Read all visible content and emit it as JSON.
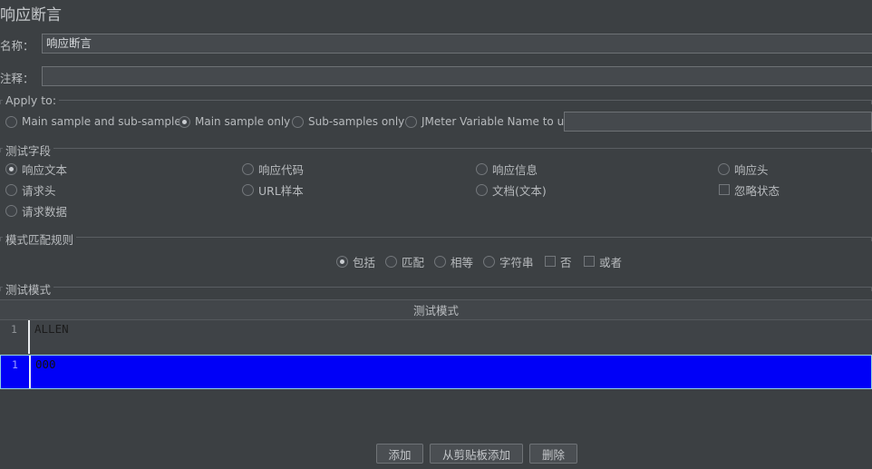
{
  "window": {
    "title": "响应断言"
  },
  "fields": {
    "name_label": "名称：",
    "name_value": "响应断言",
    "comment_label": "注释：",
    "comment_value": ""
  },
  "apply_to": {
    "group_title": "Apply to:",
    "options": [
      {
        "label": "Main sample and sub-samples",
        "checked": false
      },
      {
        "label": "Main sample only",
        "checked": true
      },
      {
        "label": "Sub-samples only",
        "checked": false
      },
      {
        "label": "JMeter Variable Name to use",
        "checked": false
      }
    ],
    "variable_value": ""
  },
  "test_field": {
    "group_title": "测试字段",
    "column1": [
      {
        "label": "响应文本",
        "checked": true,
        "type": "radio"
      },
      {
        "label": "请求头",
        "checked": false,
        "type": "radio"
      },
      {
        "label": "请求数据",
        "checked": false,
        "type": "radio"
      }
    ],
    "column2": [
      {
        "label": "响应代码",
        "checked": false,
        "type": "radio"
      },
      {
        "label": "URL样本",
        "checked": false,
        "type": "radio"
      }
    ],
    "column3": [
      {
        "label": "响应信息",
        "checked": false,
        "type": "radio"
      },
      {
        "label": "文档(文本)",
        "checked": false,
        "type": "radio"
      }
    ],
    "column4": [
      {
        "label": "响应头",
        "checked": false,
        "type": "radio"
      },
      {
        "label": "忽略状态",
        "checked": false,
        "type": "checkbox"
      }
    ]
  },
  "pattern_rules": {
    "group_title": "模式匹配规则",
    "options": [
      {
        "label": "包括",
        "checked": true,
        "type": "radio"
      },
      {
        "label": "匹配",
        "checked": false,
        "type": "radio"
      },
      {
        "label": "相等",
        "checked": false,
        "type": "radio"
      },
      {
        "label": "字符串",
        "checked": false,
        "type": "radio"
      },
      {
        "label": "否",
        "checked": false,
        "type": "checkbox"
      },
      {
        "label": "或者",
        "checked": false,
        "type": "checkbox"
      }
    ]
  },
  "test_patterns": {
    "group_title": "测试模式",
    "column_header": "测试模式",
    "rows": [
      {
        "num": "1",
        "value": "ALLEN",
        "selected": false
      },
      {
        "num": "1",
        "value": "000",
        "selected": true
      }
    ]
  },
  "buttons": {
    "add": "添加",
    "add_from_clipboard": "从剪贴板添加",
    "delete": "删除"
  },
  "colors": {
    "background": "#3c4043",
    "selection": "#0000f7",
    "selection_border": "#8fd0e0",
    "field_bg": "#45494d",
    "border": "#6d7175"
  }
}
